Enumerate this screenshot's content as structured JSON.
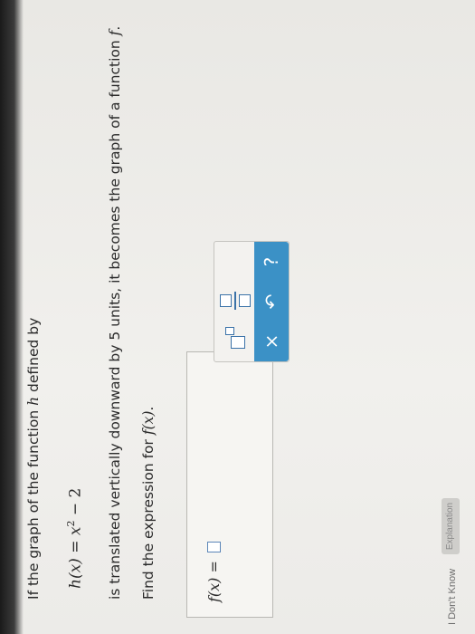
{
  "question": {
    "line1_prefix": "If the graph of the function ",
    "line1_var": "h",
    "line1_suffix": " defined by",
    "equation_lhs": "h(x)",
    "equation_eq": " = ",
    "equation_base": "x",
    "equation_exp": "2",
    "equation_rest": " − 2",
    "line3_a": "is translated vertically downward by ",
    "line3_b": "5",
    "line3_c": " units, it becomes the graph of a function ",
    "line3_d": "f",
    "line3_e": ".",
    "line4_prefix": "Find the expression for ",
    "line4_math": "f(x)",
    "line4_suffix": "."
  },
  "answer": {
    "lhs": "f(x)",
    "eq": " = "
  },
  "toolbox": {
    "clear_icon": "×",
    "undo_icon": "↶",
    "help_icon": "?"
  },
  "footer": {
    "dont_know": "I Don't Know",
    "explanation": "Explanation"
  }
}
